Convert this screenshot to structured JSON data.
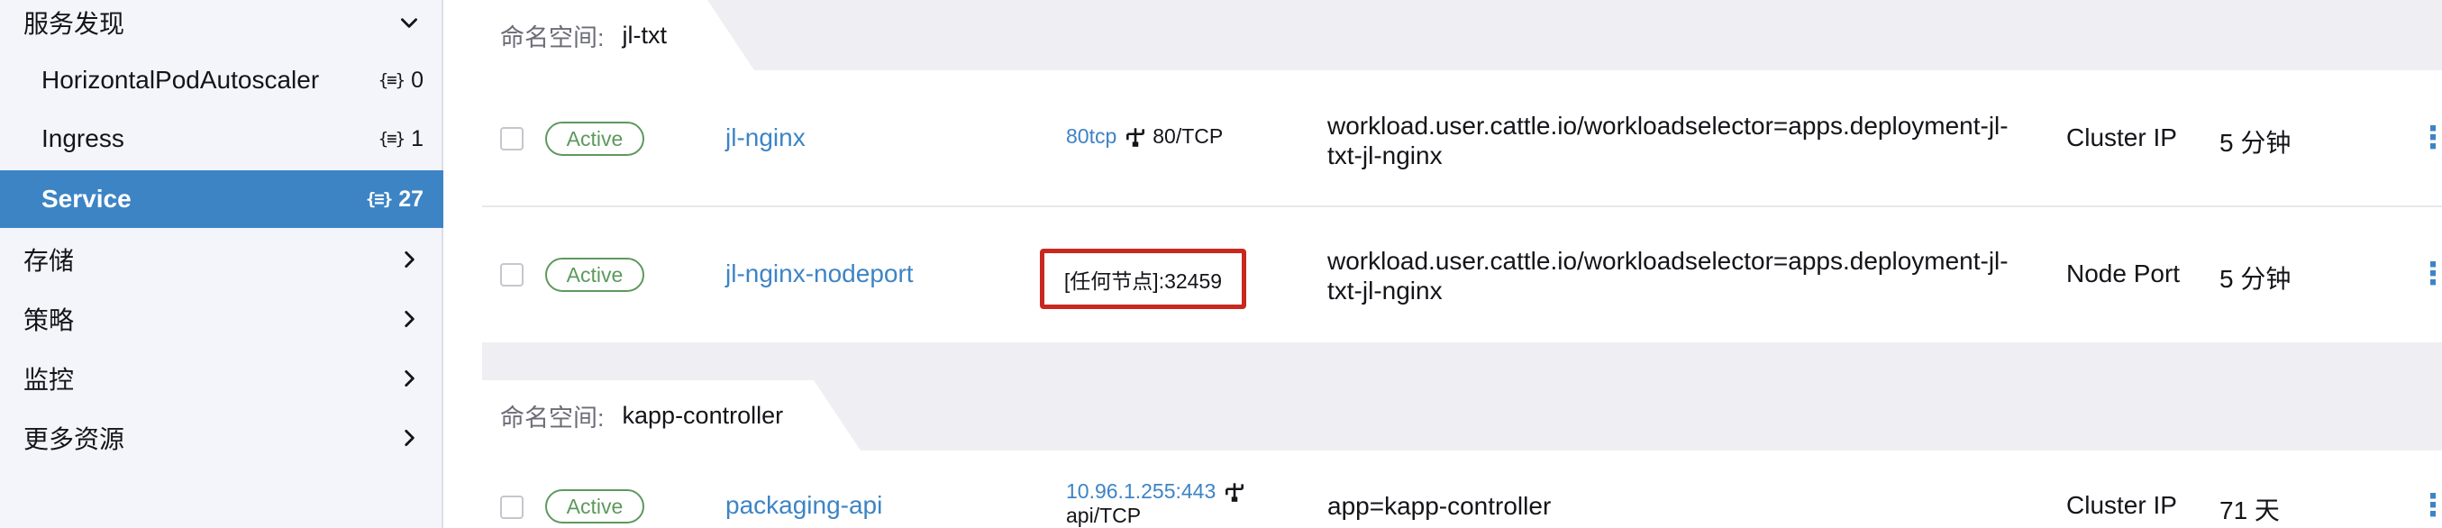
{
  "sidebar": {
    "groups_top": [
      {
        "label": "服务发现",
        "expanded": true
      }
    ],
    "sub_items": [
      {
        "label": "HorizontalPodAutoscaler",
        "count": "0",
        "active": false
      },
      {
        "label": "Ingress",
        "count": "1",
        "active": false
      },
      {
        "label": "Service",
        "count": "27",
        "active": true
      }
    ],
    "groups_bottom": [
      {
        "label": "存储"
      },
      {
        "label": "策略"
      },
      {
        "label": "监控"
      },
      {
        "label": "更多资源"
      }
    ],
    "count_icon": "{≡}"
  },
  "namespaces": [
    {
      "label": "命名空间:",
      "name": "jl-txt",
      "rows": [
        {
          "status": "Active",
          "name": "jl-nginx",
          "port_link": "80tcp",
          "port_text": "80/TCP",
          "selector": "workload.user.cattle.io/workloadselector=apps.deployment-jl-txt-jl-nginx",
          "type": "Cluster IP",
          "age": "5 分钟"
        },
        {
          "status": "Active",
          "name": "jl-nginx-nodeport",
          "port_highlight": "[任何节点]:32459",
          "selector": "workload.user.cattle.io/workloadselector=apps.deployment-jl-txt-jl-nginx",
          "type": "Node Port",
          "age": "5 分钟"
        }
      ]
    },
    {
      "label": "命名空间:",
      "name": "kapp-controller",
      "rows": [
        {
          "status": "Active",
          "name": "packaging-api",
          "port_link": "10.96.1.255:443",
          "port_text": "api/TCP",
          "selector": "app=kapp-controller",
          "type": "Cluster IP",
          "age": "71 天"
        }
      ]
    }
  ],
  "colors": {
    "accent": "#3d84c5",
    "active_badge": "#5d995d",
    "highlight_border": "#c8281e",
    "sidebar_bg": "#f4f5fa"
  },
  "icons": {
    "chevron_down": "chevron-down-icon",
    "chevron_right": "chevron-right-icon",
    "network": "network-icon",
    "kebab": "kebab-menu-icon"
  }
}
